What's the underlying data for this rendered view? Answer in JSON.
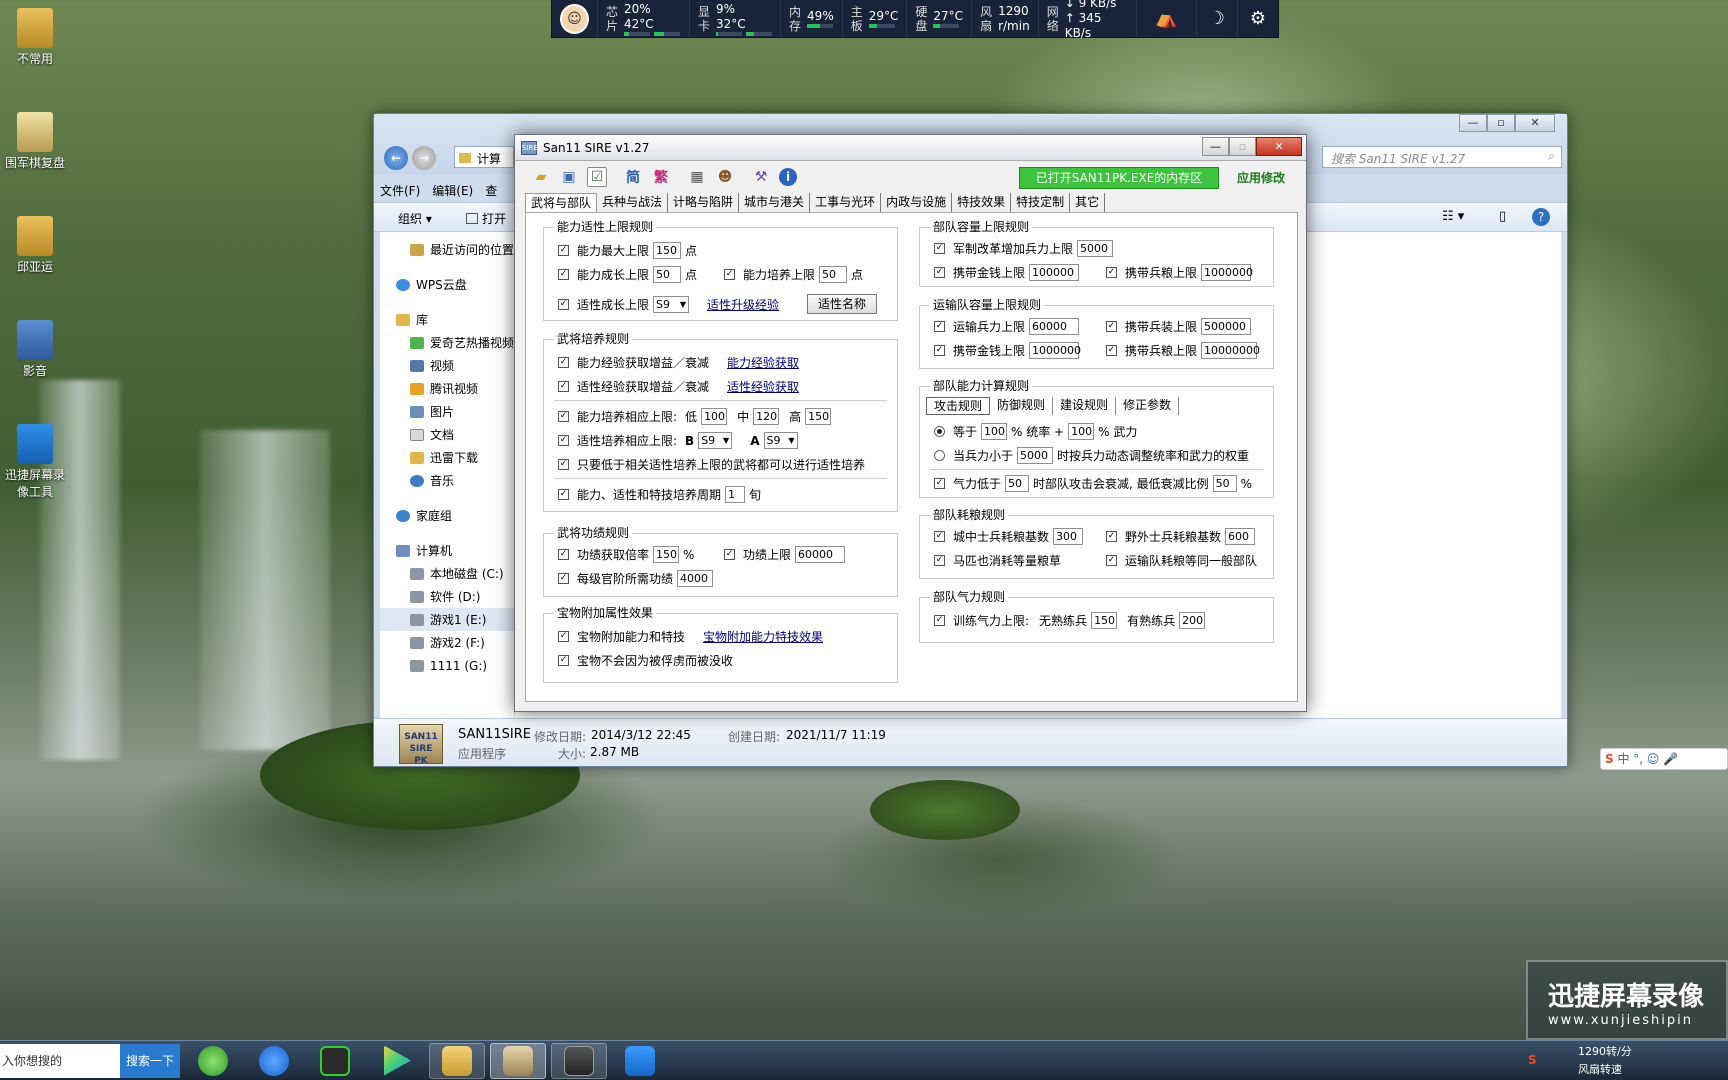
{
  "monitor": {
    "cpu": {
      "lab1": "芯",
      "lab2": "片",
      "usage": "20%",
      "temp": "42°C",
      "fill": 0.2
    },
    "gpu": {
      "lab1": "显",
      "lab2": "卡",
      "usage": "9%",
      "temp": "32°C",
      "fill": 0.09
    },
    "mem": {
      "lab1": "内",
      "lab2": "存",
      "usage": "49%",
      "fill": 0.49
    },
    "board": {
      "lab1": "主",
      "lab2": "板",
      "temp": "29°C"
    },
    "disk": {
      "lab1": "硬",
      "lab2": "盘",
      "temp": "27°C"
    },
    "fan": {
      "lab1": "风",
      "lab2": "扇",
      "rpm": "1290",
      "unit": "r/min"
    },
    "net": {
      "lab1": "网",
      "lab2": "络",
      "down": "↓ 9 KB/s",
      "up": "↑ 345 KB/s"
    }
  },
  "desktop_icons": [
    "不常用",
    "围军棋复盘",
    "邱亚运",
    "影音",
    "迅捷屏幕录像工具"
  ],
  "explorer": {
    "address": "计算",
    "search_placeholder": "搜索 San11 SIRE v1.27",
    "menu": [
      "文件(F)",
      "编辑(E)",
      "查"
    ],
    "toolbar": {
      "organize": "组织 ▾",
      "open": "打开"
    },
    "nav": {
      "recent": "最近访问的位置",
      "wps": "WPS云盘",
      "library": "库",
      "library_items": [
        "爱奇艺热播视频",
        "视频",
        "腾讯视频",
        "图片",
        "文档",
        "迅雷下载",
        "音乐"
      ],
      "homegroup": "家庭组",
      "computer": "计算机",
      "drives": [
        "本地磁盘 (C:)",
        "软件 (D:)",
        "游戏1 (E:)",
        "游戏2 (F:)",
        "1111 (G:)"
      ]
    },
    "status": {
      "name": "SAN11SIRE",
      "modified_label": "修改日期:",
      "modified": "2014/3/12 22:45",
      "created_label": "创建日期:",
      "created": "2021/11/7 11:19",
      "type": "应用程序",
      "size_label": "大小:",
      "size": "2.87 MB"
    }
  },
  "sire": {
    "title": "San11 SIRE v1.27",
    "tool_jian": "简",
    "tool_fan": "繁",
    "mem_button": "已打开SAN11PK.EXE的内存区",
    "apply_button": "应用修改",
    "tabs": [
      "武将与部队",
      "兵种与战法",
      "计略与陷阱",
      "城市与港关",
      "工事与光环",
      "内政与设施",
      "特技效果",
      "特技定制",
      "其它"
    ],
    "g1": {
      "title": "能力适性上限规则",
      "max_label": "能力最大上限",
      "max_val": "150",
      "max_unit": "点",
      "grow_label": "能力成长上限",
      "grow_val": "50",
      "grow_unit": "点",
      "train_label": "能力培养上限",
      "train_val": "50",
      "train_unit": "点",
      "apt_label": "适性成长上限",
      "apt_val": "S9",
      "apt_link": "适性升级经验",
      "apt_btn": "适性名称"
    },
    "g2": {
      "title": "武将培养规则",
      "r1": "能力经验获取增益／衰减",
      "r1_link": "能力经验获取",
      "r2": "适性经验获取增益／衰减",
      "r2_link": "适性经验获取",
      "r3": "能力培养相应上限:",
      "low": "低",
      "low_val": "100",
      "mid": "中",
      "mid_val": "120",
      "high": "高",
      "high_val": "150",
      "r4": "适性培养相应上限:",
      "b": "B",
      "b_val": "S9",
      "a": "A",
      "a_val": "S9",
      "r5": "只要低于相关适性培养上限的武将都可以进行适性培养",
      "r6": "能力、适性和特技培养周期",
      "r6_val": "1",
      "r6_unit": "旬"
    },
    "g3": {
      "title": "武将功绩规则",
      "rate_label": "功绩获取倍率",
      "rate_val": "150",
      "rate_unit": "%",
      "cap_label": "功绩上限",
      "cap_val": "60000",
      "rank_label": "每级官阶所需功绩",
      "rank_val": "4000"
    },
    "g4": {
      "title": "宝物附加属性效果",
      "r1": "宝物附加能力和特技",
      "r1_link": "宝物附加能力特技效果",
      "r2": "宝物不会因为被俘虏而被没收"
    },
    "g5": {
      "title": "部队容量上限规则",
      "r1": "军制改革增加兵力上限",
      "r1_val": "5000",
      "gold_label": "携带金钱上限",
      "gold_val": "100000",
      "food_label": "携带兵粮上限",
      "food_val": "1000000"
    },
    "g6": {
      "title": "运输队容量上限规则",
      "troop_label": "运输兵力上限",
      "troop_val": "60000",
      "equip_label": "携带兵装上限",
      "equip_val": "500000",
      "gold_label": "携带金钱上限",
      "gold_val": "1000000",
      "food_label": "携带兵粮上限",
      "food_val": "10000000"
    },
    "g7": {
      "title": "部队能力计算规则",
      "subtabs": [
        "攻击规则",
        "防御规则",
        "建设规则",
        "修正参数"
      ],
      "r1a": "等于",
      "r1_v1": "100",
      "r1b": "% 统率 +",
      "r1_v2": "100",
      "r1c": "% 武力",
      "r2a": "当兵力小于",
      "r2_val": "5000",
      "r2b": "时按兵力动态调整统率和武力的权重",
      "r3a": "气力低于",
      "r3_val": "50",
      "r3b": "时部队攻击会衰减, 最低衰减比例",
      "r3_v2": "50",
      "r3c": "%"
    },
    "g8": {
      "title": "部队耗粮规则",
      "city_label": "城中士兵耗粮基数",
      "city_val": "300",
      "field_label": "野外士兵耗粮基数",
      "field_val": "600",
      "horse": "马匹也消耗等量粮草",
      "transport": "运输队耗粮等同一般部队"
    },
    "g9": {
      "title": "部队气力规则",
      "label": "训练气力上限:",
      "raw": "无熟练兵",
      "raw_val": "150",
      "skilled": "有熟练兵",
      "skilled_val": "200"
    }
  },
  "taskbar": {
    "search_text": "入你想搜的",
    "search_button": "搜索一下",
    "tray_fan": "1290转/分",
    "tray_fan2": "风扇转速"
  },
  "watermark": {
    "line1": "迅捷屏幕录像",
    "line2": "www.xunjieshipin"
  }
}
